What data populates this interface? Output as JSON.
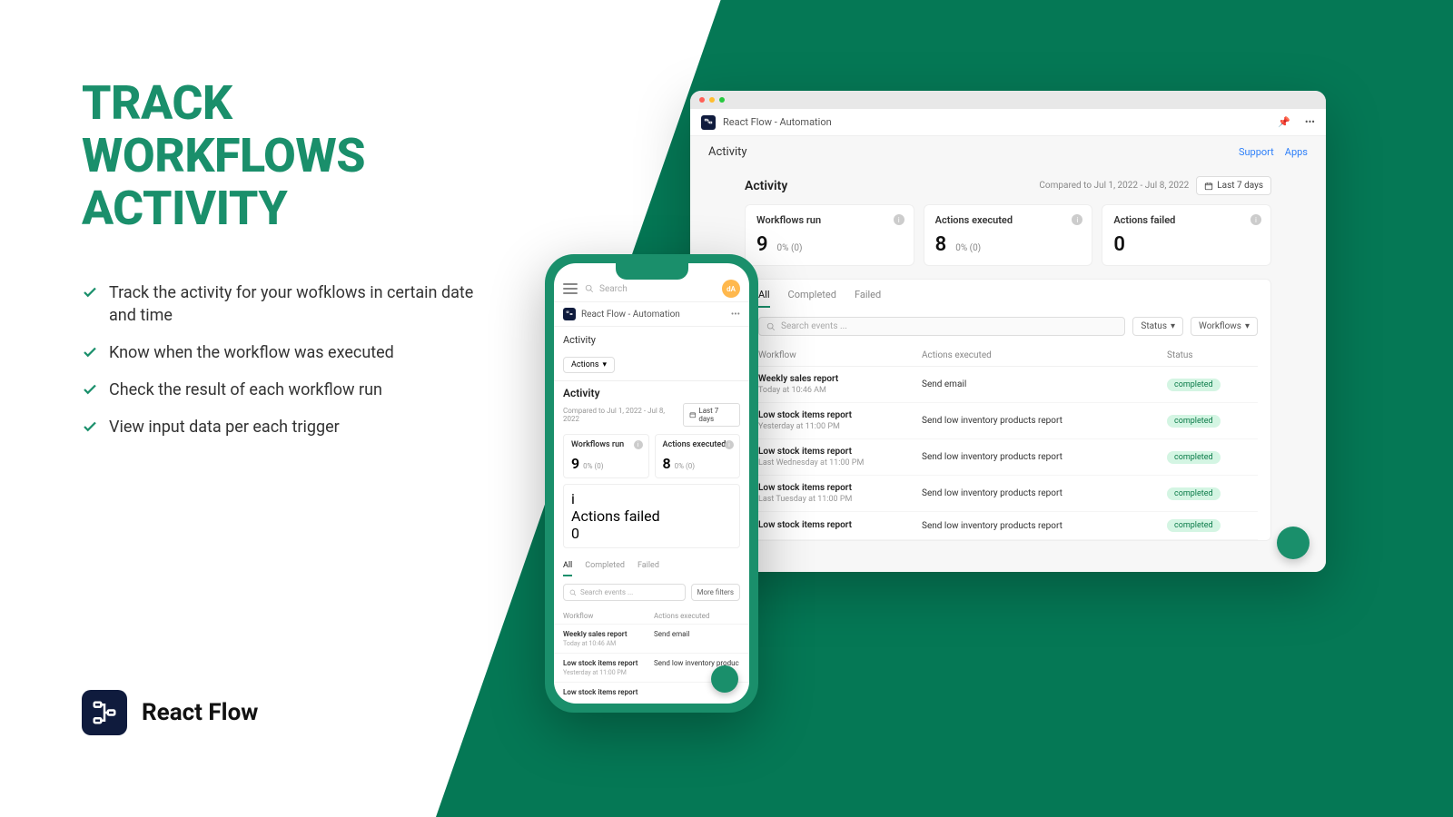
{
  "marketing": {
    "title_line1": "TRACK",
    "title_line2": "WORKFLOWS",
    "title_line3": "ACTIVITY",
    "bullets": [
      "Track the activity for your wofklows in certain date and time",
      "Know when the workflow was executed",
      "Check the result of each workflow run",
      "View input data per each trigger"
    ],
    "brand": "React Flow"
  },
  "app": {
    "window_title": "React Flow - Automation",
    "header_links": {
      "support": "Support",
      "apps": "Apps"
    },
    "page_heading": "Activity",
    "section_heading": "Activity",
    "compared_text": "Compared to Jul 1, 2022 - Jul 8, 2022",
    "date_button": "Last 7 days",
    "stats": {
      "workflows_run": {
        "label": "Workflows run",
        "value": "9",
        "pct": "0% (0)"
      },
      "actions_executed": {
        "label": "Actions executed",
        "value": "8",
        "pct": "0% (0)"
      },
      "actions_failed": {
        "label": "Actions failed",
        "value": "0"
      }
    },
    "tabs": {
      "all": "All",
      "completed": "Completed",
      "failed": "Failed"
    },
    "search_placeholder": "Search events ...",
    "filter_status": "Status",
    "filter_workflows": "Workflows",
    "columns": {
      "workflow": "Workflow",
      "actions": "Actions executed",
      "status": "Status"
    },
    "rows": [
      {
        "title": "Weekly sales report",
        "time": "Today at 10:46 AM",
        "action": "Send email",
        "status": "completed"
      },
      {
        "title": "Low stock items report",
        "time": "Yesterday at 11:00 PM",
        "action": "Send low inventory products report",
        "status": "completed"
      },
      {
        "title": "Low stock items report",
        "time": "Last Wednesday at 11:00 PM",
        "action": "Send low inventory products report",
        "status": "completed"
      },
      {
        "title": "Low stock items report",
        "time": "Last Tuesday at 11:00 PM",
        "action": "Send low inventory products report",
        "status": "completed"
      },
      {
        "title": "Low stock items report",
        "time": "",
        "action": "Send low inventory products report",
        "status": "completed"
      }
    ]
  },
  "mobile": {
    "search_placeholder": "Search",
    "avatar": "dA",
    "header": "React Flow - Automation",
    "page_heading": "Activity",
    "actions_button": "Actions",
    "section_heading": "Activity",
    "compared_text": "Compared to Jul 1, 2022 - Jul 8, 2022",
    "date_button": "Last 7 days",
    "stats": {
      "workflows_run": {
        "label": "Workflows run",
        "value": "9",
        "pct": "0%  (0)"
      },
      "actions_executed": {
        "label": "Actions executed",
        "value": "8",
        "pct": "0%  (0)"
      },
      "actions_failed": {
        "label": "Actions failed",
        "value": "0"
      }
    },
    "tabs": {
      "all": "All",
      "completed": "Completed",
      "failed": "Failed"
    },
    "search_events_placeholder": "Search events ...",
    "more_filters": "More filters",
    "columns": {
      "workflow": "Workflow",
      "actions": "Actions executed"
    },
    "rows": [
      {
        "title": "Weekly sales report",
        "time": "Today at 10:46 AM",
        "action": "Send email"
      },
      {
        "title": "Low stock items report",
        "time": "Yesterday at 11:00 PM",
        "action": "Send low inventory produc"
      },
      {
        "title": "Low stock items report",
        "time": "",
        "action": ""
      }
    ]
  }
}
